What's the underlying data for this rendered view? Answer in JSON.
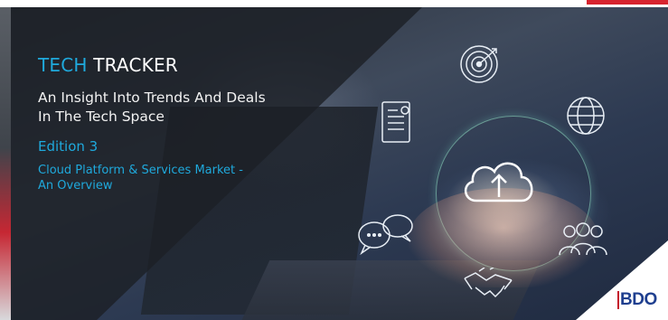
{
  "banner": {
    "title_accent": "TECH",
    "title_main": " TRACKER",
    "subtitle": "An Insight Into Trends And Deals In The Tech Space",
    "edition": "Edition 3",
    "topic": "Cloud Platform & Services Market - An Overview"
  },
  "logo": {
    "text": "BDO"
  },
  "icons": [
    "target-icon",
    "document-icon",
    "globe-icon",
    "cloud-upload-icon",
    "chat-bubbles-icon",
    "handshake-icon",
    "people-group-icon"
  ],
  "colors": {
    "accent_blue": "#1fa9dc",
    "logo_blue": "#1f3f8f",
    "logo_red": "#c4162a",
    "overlay_dark": "#1c2026"
  }
}
